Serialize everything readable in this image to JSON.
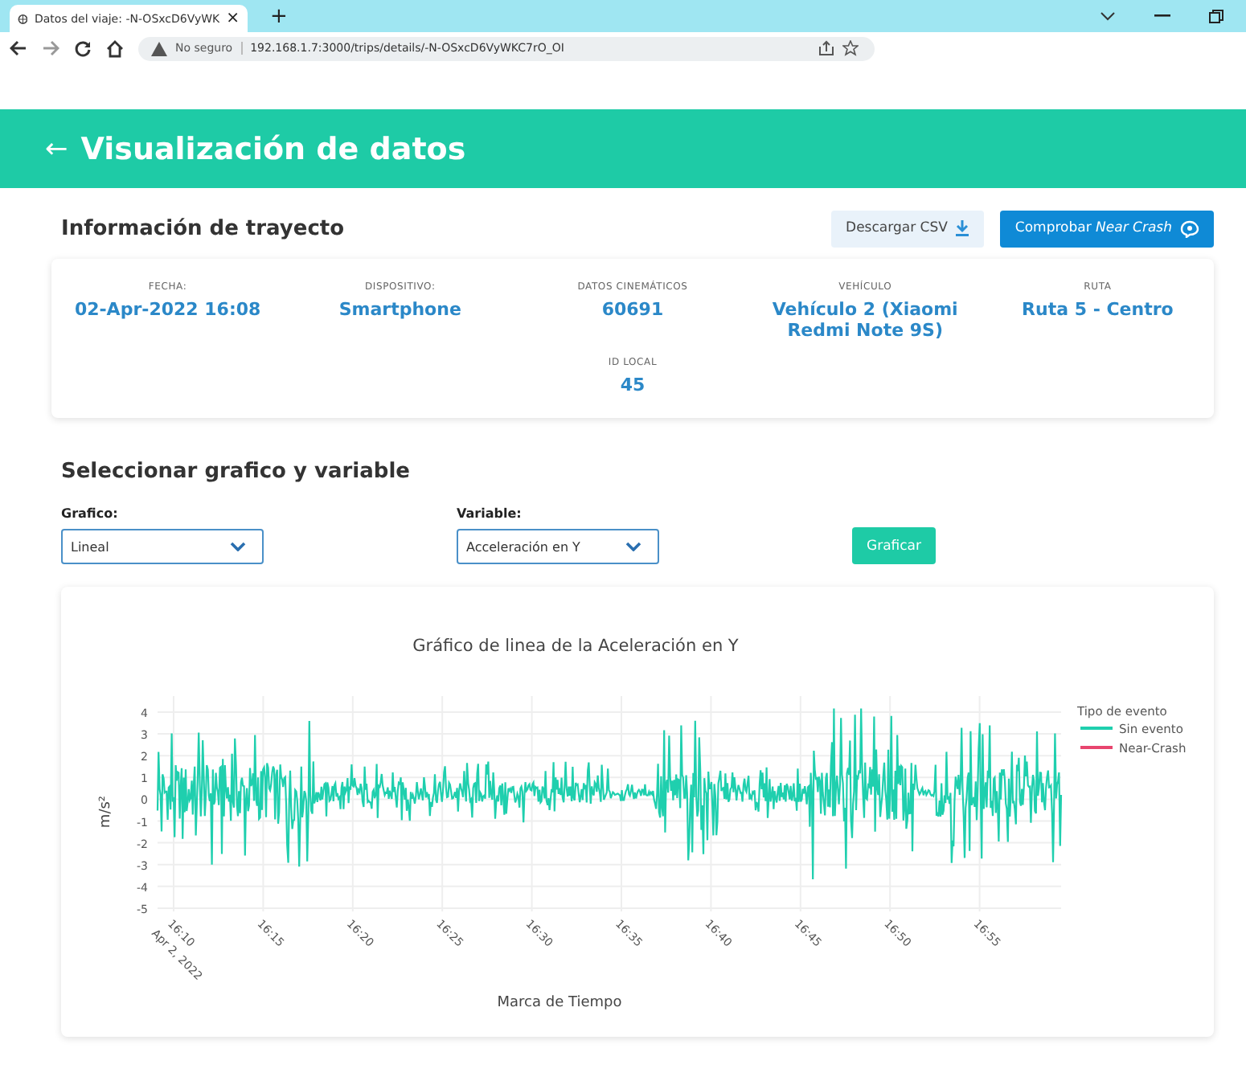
{
  "browser": {
    "tab_title": "Datos del viaje: -N-OSxcD6VyWK",
    "tab_close": "×",
    "new_tab": "+",
    "security": "No seguro",
    "url": "192.168.1.7:3000/trips/details/-N-OSxcD6VyWKC7rO_OI"
  },
  "header": {
    "back": "←",
    "title": "Visualización de datos"
  },
  "trip": {
    "title": "Información de trayecto",
    "buttons": [
      {
        "kind": "download",
        "label": "Descargar CSV"
      },
      {
        "kind": "check",
        "label": "Comprobar *Near Crash*"
      }
    ],
    "fields": [
      {
        "label": "FECHA:",
        "value": "02-Apr-2022 16:08"
      },
      {
        "label": "DISPOSITIVO:",
        "value": "Smartphone"
      },
      {
        "label": "DATOS CINEMÁTICOS",
        "value": "60691"
      },
      {
        "label": "VEHÍCULO",
        "value": "Vehículo 2 (Xiaomi Redmi Note 9S)"
      },
      {
        "label": "RUTA",
        "value": "Ruta 5 - Centro"
      }
    ],
    "extra": {
      "label": "ID LOCAL",
      "value": "45"
    }
  },
  "selector": {
    "title": "Seleccionar grafico y variable",
    "chart_type": {
      "label": "Grafico:",
      "value": "Lineal"
    },
    "variable": {
      "label": "Variable:",
      "value": "Acceleración en Y"
    },
    "button": "Graficar"
  },
  "chart": {
    "title": "Gráfico de linea de la Aceleración en Y",
    "xlabel": "Marca de Tiempo",
    "ylabel": "m/s²",
    "yticks": [
      "4",
      "3",
      "2",
      "1",
      "0",
      "-1",
      "-2",
      "-3",
      "-4",
      "-5"
    ],
    "xticks": [
      "16:10",
      "16:15",
      "16:20",
      "16:25",
      "16:30",
      "16:35",
      "16:40",
      "16:45",
      "16:50",
      "16:55"
    ],
    "xdate": "Apr 2, 2022",
    "legend_title": "Tipo de evento",
    "legend": [
      {
        "name": "Sin evento",
        "color": "#1fcfae"
      },
      {
        "name": "Near-Crash",
        "color": "#e8456e"
      }
    ]
  }
}
